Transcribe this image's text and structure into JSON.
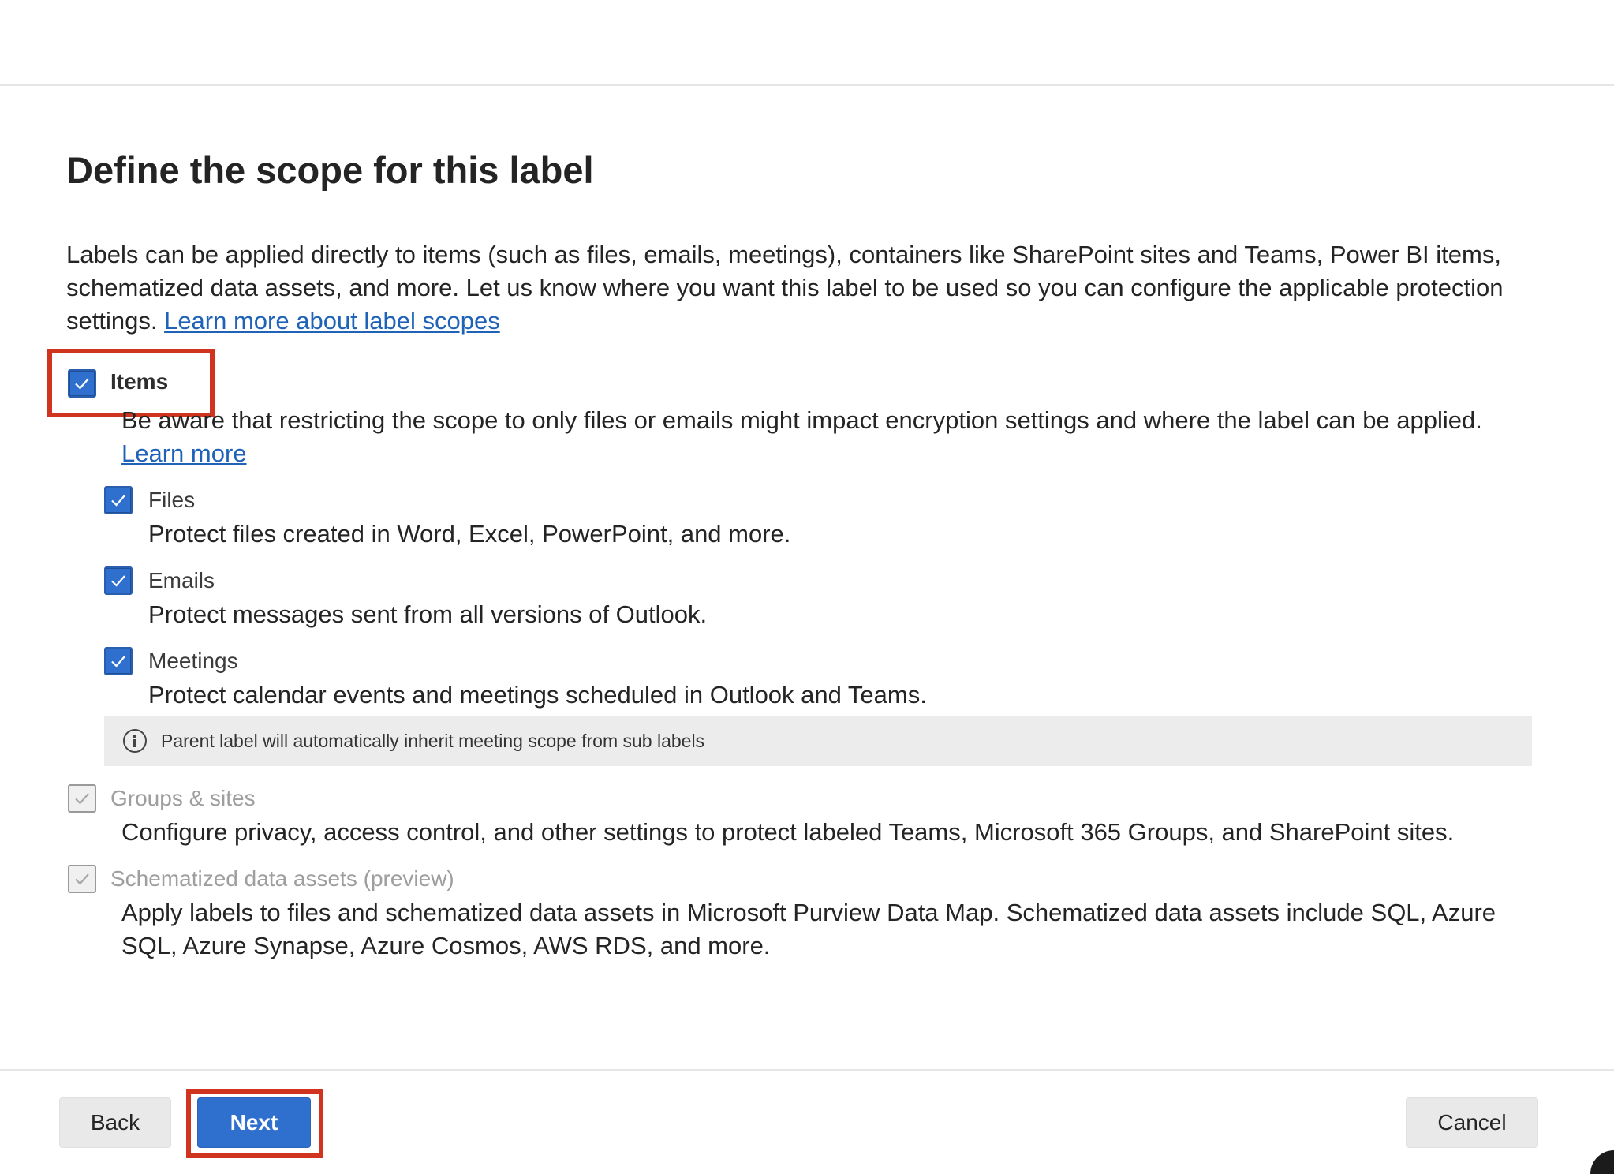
{
  "page": {
    "title": "Define the scope for this label",
    "intro_text": "Labels can be applied directly to items (such as files, emails, meetings), containers like SharePoint sites and Teams, Power BI items, schematized data assets, and more. Let us know where you want this label to be used so you can configure the applicable protection settings.",
    "intro_link": "Learn more about label scopes"
  },
  "options": {
    "items": {
      "label": "Items",
      "checked": true,
      "description": "Be aware that restricting the scope to only files or emails might impact encryption settings and where the label can be applied.",
      "description_link": "Learn more",
      "sub": {
        "files": {
          "label": "Files",
          "checked": true,
          "description": "Protect files created in Word, Excel, PowerPoint, and more."
        },
        "emails": {
          "label": "Emails",
          "checked": true,
          "description": "Protect messages sent from all versions of Outlook."
        },
        "meetings": {
          "label": "Meetings",
          "checked": true,
          "description": "Protect calendar events and meetings scheduled in Outlook and Teams."
        }
      },
      "info_message": "Parent label will automatically inherit meeting scope from sub labels"
    },
    "groups_sites": {
      "label": "Groups & sites",
      "checked": true,
      "disabled": true,
      "description": "Configure privacy, access control, and other settings to protect labeled Teams, Microsoft 365 Groups, and SharePoint sites."
    },
    "schematized": {
      "label": "Schematized data assets (preview)",
      "checked": true,
      "disabled": true,
      "description": "Apply labels to files and schematized data assets in Microsoft Purview Data Map. Schematized data assets include SQL, Azure SQL, Azure Synapse, Azure Cosmos, AWS RDS, and more."
    }
  },
  "footer": {
    "back_label": "Back",
    "next_label": "Next",
    "cancel_label": "Cancel"
  },
  "colors": {
    "accent": "#2f6fce",
    "link": "#1f63b8",
    "highlight": "#d0341e",
    "info_bar": "#ececec"
  },
  "icons": {
    "checkmark": "checkmark-icon",
    "info": "info-icon"
  }
}
